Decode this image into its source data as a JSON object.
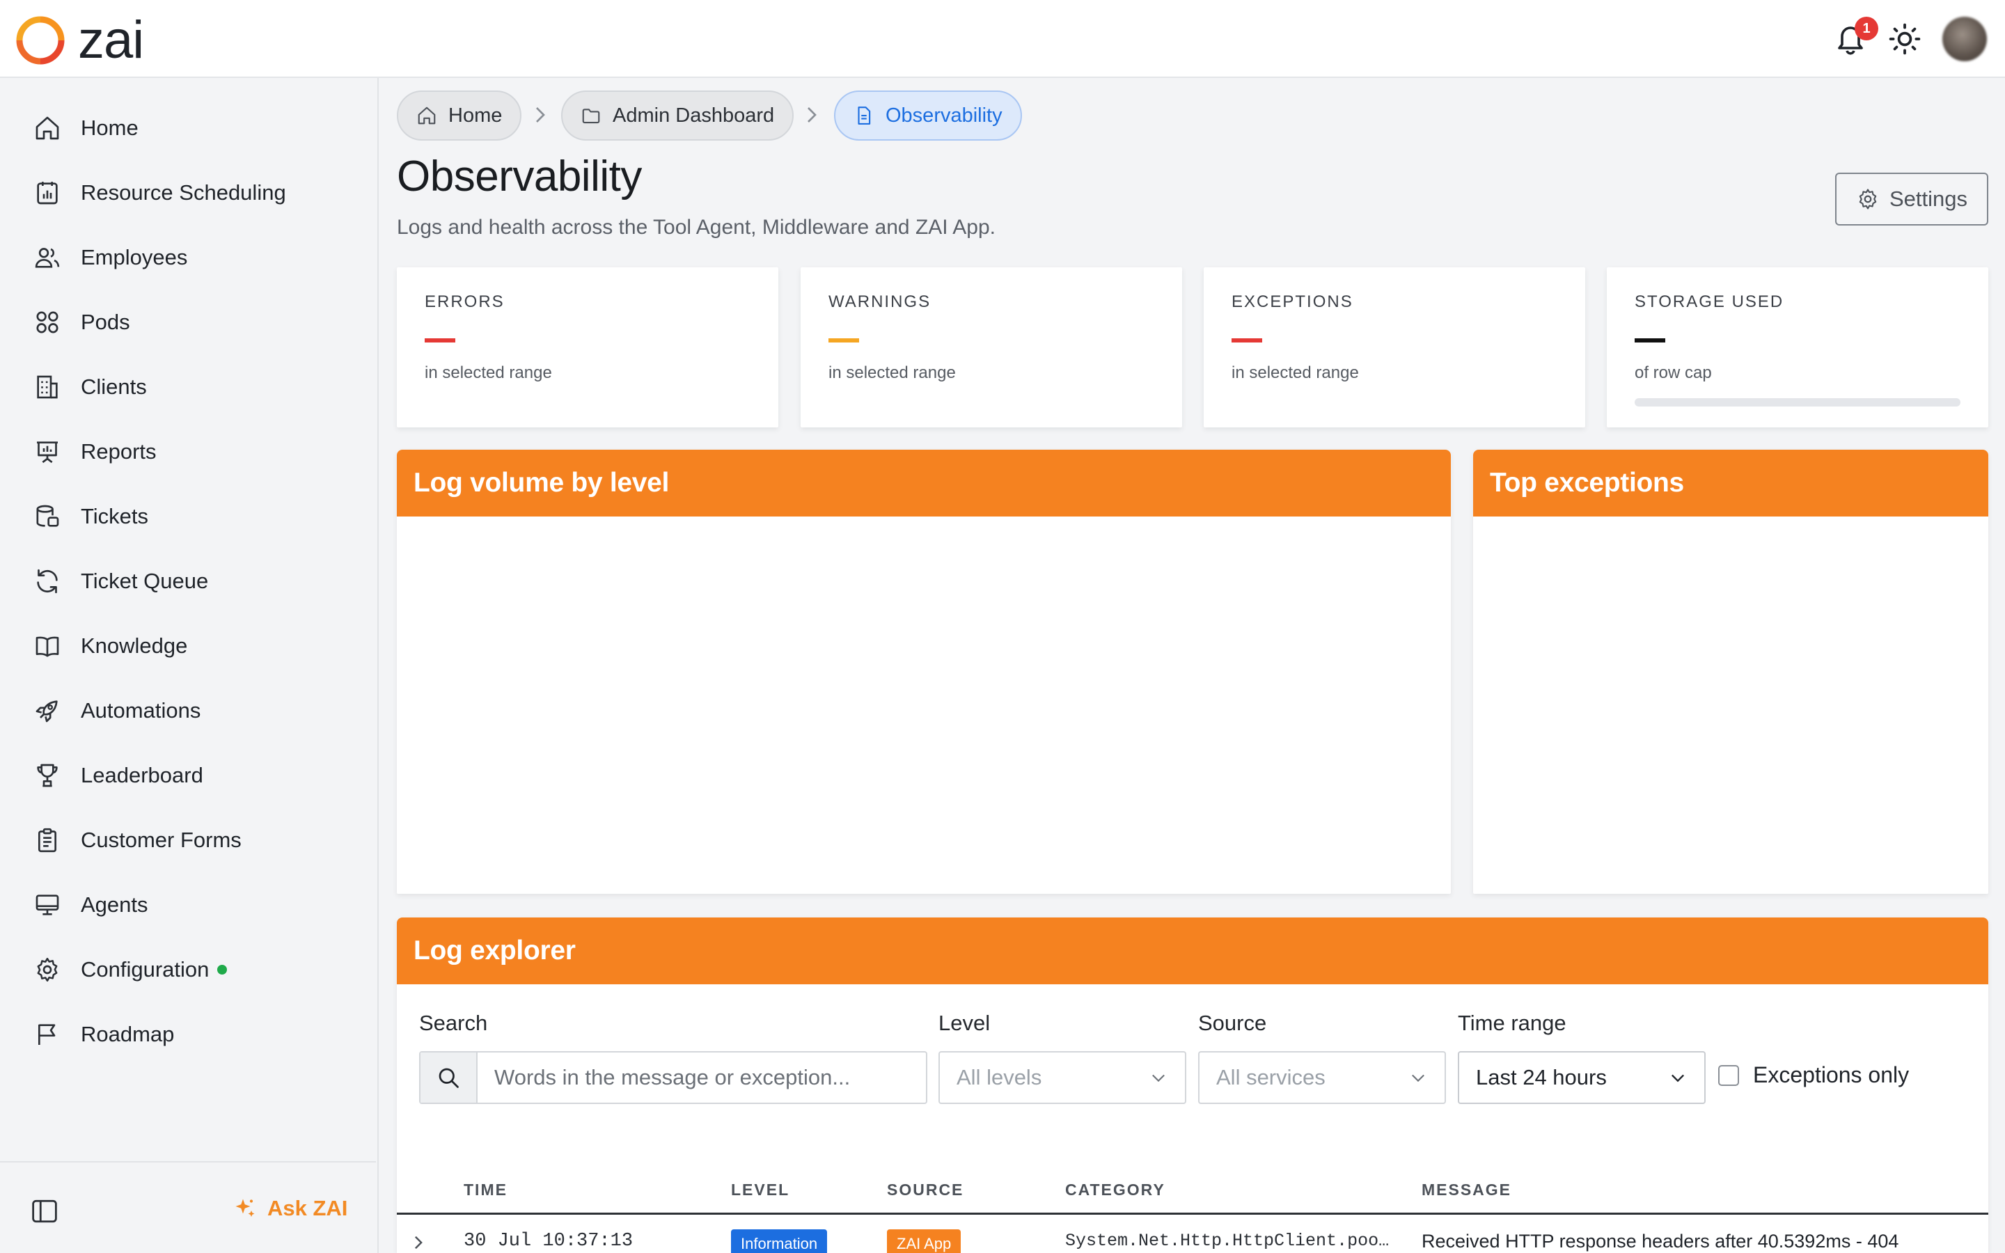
{
  "app": {
    "brand": "zai",
    "notification_count": "1"
  },
  "sidebar": {
    "items": [
      {
        "label": "Home",
        "icon": "home-icon"
      },
      {
        "label": "Resource Scheduling",
        "icon": "calendar-chart-icon"
      },
      {
        "label": "Employees",
        "icon": "users-icon"
      },
      {
        "label": "Pods",
        "icon": "grid-circles-icon"
      },
      {
        "label": "Clients",
        "icon": "building-icon"
      },
      {
        "label": "Reports",
        "icon": "presentation-chart-icon"
      },
      {
        "label": "Tickets",
        "icon": "database-ticket-icon"
      },
      {
        "label": "Ticket Queue",
        "icon": "refresh-icon"
      },
      {
        "label": "Knowledge",
        "icon": "book-icon"
      },
      {
        "label": "Automations",
        "icon": "rocket-icon"
      },
      {
        "label": "Leaderboard",
        "icon": "trophy-icon"
      },
      {
        "label": "Customer Forms",
        "icon": "clipboard-icon"
      },
      {
        "label": "Agents",
        "icon": "monitor-icon"
      },
      {
        "label": "Configuration",
        "icon": "gear-icon",
        "status_dot": "#1faa4a"
      },
      {
        "label": "Roadmap",
        "icon": "flag-icon"
      }
    ],
    "ask_label": "Ask ZAI"
  },
  "breadcrumb": {
    "items": [
      {
        "label": "Home",
        "icon": "home-icon"
      },
      {
        "label": "Admin Dashboard",
        "icon": "folder-icon"
      },
      {
        "label": "Observability",
        "icon": "document-icon",
        "active": true
      }
    ]
  },
  "page": {
    "title": "Observability",
    "subtitle": "Logs and health across the Tool Agent, Middleware and ZAI App.",
    "settings_label": "Settings"
  },
  "stats": [
    {
      "label": "ERRORS",
      "sub": "in selected range",
      "color": "#e53935"
    },
    {
      "label": "WARNINGS",
      "sub": "in selected range",
      "color": "#f5a623"
    },
    {
      "label": "EXCEPTIONS",
      "sub": "in selected range",
      "color": "#e53935"
    },
    {
      "label": "STORAGE USED",
      "sub": "of row cap",
      "color": "#111111",
      "progress": 0
    }
  ],
  "panels": {
    "log_volume_title": "Log volume by level",
    "top_exceptions_title": "Top exceptions",
    "log_explorer_title": "Log explorer"
  },
  "filters": {
    "search_label": "Search",
    "search_placeholder": "Words in the message or exception...",
    "level_label": "Level",
    "level_value": "All levels",
    "source_label": "Source",
    "source_value": "All services",
    "time_label": "Time range",
    "time_value": "Last 24 hours",
    "exceptions_only_label": "Exceptions only"
  },
  "table": {
    "columns": [
      "TIME",
      "LEVEL",
      "SOURCE",
      "CATEGORY",
      "MESSAGE"
    ],
    "rows": [
      {
        "time": "30 Jul 10:37:13",
        "level": "Information",
        "source": "ZAI App",
        "category": "System.Net.Http.HttpClient.poo…",
        "message": "Received HTTP response headers after 40.5392ms - 404"
      }
    ]
  },
  "colors": {
    "accent": "#f58220",
    "active_crumb": "#1c6ee0",
    "level_information": "#1c6ee0",
    "source_zai_app": "#f58220"
  }
}
